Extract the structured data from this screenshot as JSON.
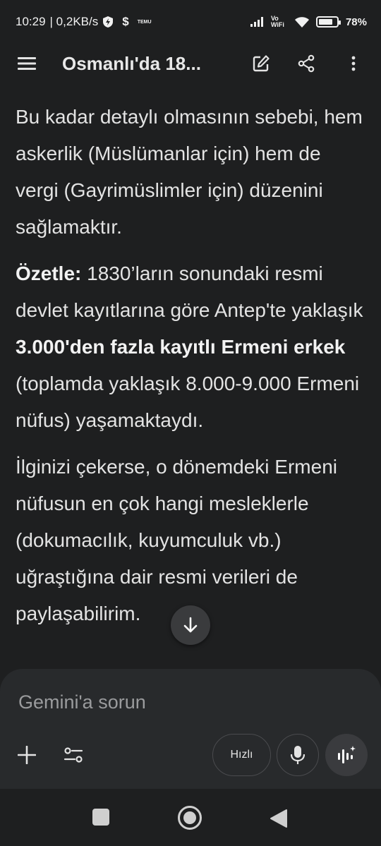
{
  "status_bar": {
    "time": "10:29",
    "network_speed": "| 0,2KB/s",
    "temu_badge": "TEMU",
    "vowifi": "Vo WiFi",
    "battery_percent": "78%",
    "battery_level": 0.78
  },
  "app_bar": {
    "title": "Osmanlı'da 18...",
    "icons": [
      "menu-icon",
      "edit-icon",
      "share-icon",
      "more-vert-icon"
    ]
  },
  "response": {
    "p1": "Bu kadar detaylı olmasının sebebi, hem askerlik (Müslümanlar için) hem de vergi (Gayrimüslimler için) düzenini sağlamaktır.",
    "p2_bold_label": "Özetle:",
    "p2_text_a": " 1830’ların sonundaki resmi devlet kayıtlarına göre Antep'te yaklaşık ",
    "p2_bold_b": "3.000'den fazla kayıtlı Ermeni erkek",
    "p2_text_c": " (toplamda yaklaşık 8.000-9.000 Ermeni nüfus) yaşamaktaydı.",
    "p3": "İlginizi çekerse, o dönemdeki Ermeni nüfusun en çok hangi mesleklerle (dokumacılık, kuyumculuk vb.) uğraştığına dair resmi verileri de paylaşabilirim."
  },
  "input": {
    "placeholder": "Gemini'a sorun",
    "mode_label": "Hızlı"
  },
  "colors": {
    "background": "#1e1f20",
    "panel": "#282a2c",
    "text": "#e3e3e3",
    "placeholder": "#9a9b9d"
  }
}
